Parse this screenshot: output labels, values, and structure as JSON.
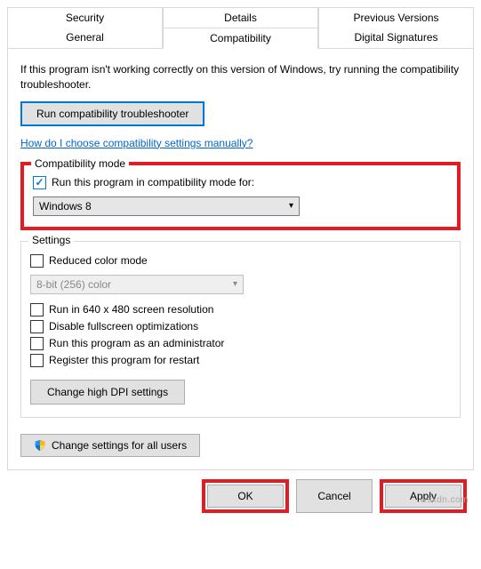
{
  "tabs_row1": {
    "security": "Security",
    "details": "Details",
    "previous": "Previous Versions"
  },
  "tabs_row2": {
    "general": "General",
    "compatibility": "Compatibility",
    "signatures": "Digital Signatures"
  },
  "intro": "If this program isn't working correctly on this version of Windows, try running the compatibility troubleshooter.",
  "troubleshooter_btn": "Run compatibility troubleshooter",
  "help_link": "How do I choose compatibility settings manually?",
  "compat_group": {
    "legend": "Compatibility mode",
    "checkbox_label": "Run this program in compatibility mode for:",
    "select_value": "Windows 8"
  },
  "settings_group": {
    "legend": "Settings",
    "reduced_color": "Reduced color mode",
    "color_select": "8-bit (256) color",
    "res640": "Run in 640 x 480 screen resolution",
    "disable_fs": "Disable fullscreen optimizations",
    "run_admin": "Run this program as an administrator",
    "register_restart": "Register this program for restart",
    "dpi_btn": "Change high DPI settings"
  },
  "allusers_btn": "Change settings for all users",
  "footer": {
    "ok": "OK",
    "cancel": "Cancel",
    "apply": "Apply"
  },
  "watermark": "wsxdn.com"
}
